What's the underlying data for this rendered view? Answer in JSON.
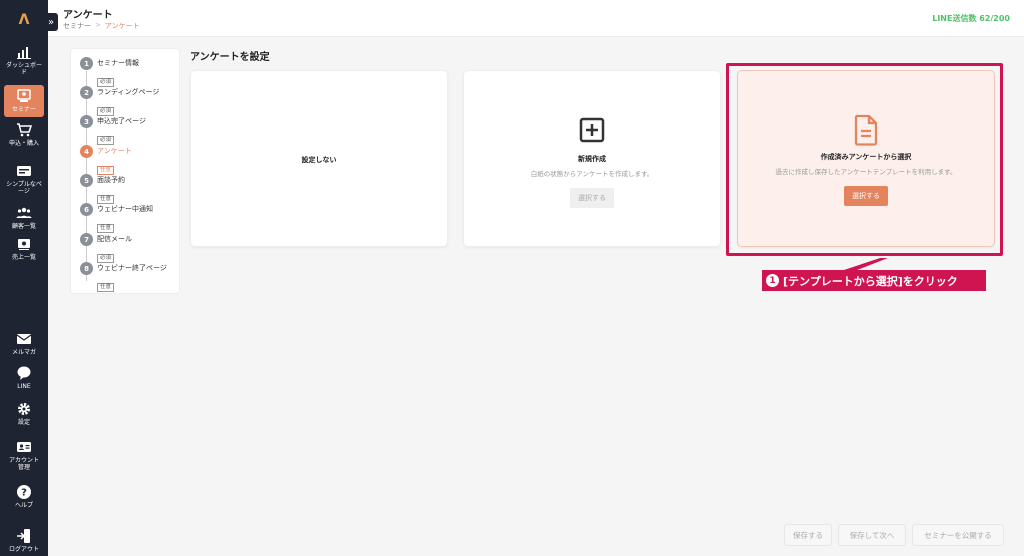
{
  "app": {
    "logo": "Λ"
  },
  "sidebar": {
    "items": [
      {
        "label": "ダッシュボード",
        "icon": "chart-icon"
      },
      {
        "label": "セミナー",
        "icon": "seminar-icon"
      },
      {
        "label": "申込・購入",
        "icon": "cart-icon"
      },
      {
        "label": "シンプルなページ",
        "icon": "page-icon"
      },
      {
        "label": "顧客一覧",
        "icon": "users-icon"
      },
      {
        "label": "売上一覧",
        "icon": "sales-icon"
      },
      {
        "label": "メルマガ",
        "icon": "mail-icon"
      },
      {
        "label": "LINE",
        "icon": "line-icon"
      },
      {
        "label": "設定",
        "icon": "gear-icon"
      },
      {
        "label": "アカウント管理",
        "icon": "account-icon"
      },
      {
        "label": "ヘルプ",
        "icon": "help-icon"
      },
      {
        "label": "ログアウト",
        "icon": "logout-icon"
      }
    ]
  },
  "header": {
    "title": "アンケート",
    "breadcrumb": {
      "parent": "セミナー",
      "separator": ">",
      "current": "アンケート"
    },
    "line_count": "LINE送信数 62/200"
  },
  "steps": [
    {
      "num": "1",
      "label": "セミナー情報",
      "badge": "必須"
    },
    {
      "num": "2",
      "label": "ランディングページ",
      "badge": "必須"
    },
    {
      "num": "3",
      "label": "申込完了ページ",
      "badge": "必須"
    },
    {
      "num": "4",
      "label": "アンケート",
      "badge": "任意"
    },
    {
      "num": "5",
      "label": "面談予約",
      "badge": "任意"
    },
    {
      "num": "6",
      "label": "ウェビナー中通知",
      "badge": "任意"
    },
    {
      "num": "7",
      "label": "配信メール",
      "badge": "必須"
    },
    {
      "num": "8",
      "label": "ウェビナー終了ページ",
      "badge": "任意"
    }
  ],
  "main": {
    "section_title": "アンケートを設定",
    "cards": {
      "none": {
        "title": "設定しない"
      },
      "new": {
        "title": "新規作成",
        "desc": "白紙の状態からアンケートを作成します。",
        "button": "選択する"
      },
      "template": {
        "title": "作成済みアンケートから選択",
        "desc": "過去に作成し保存したアンケートテンプレートを利用します。",
        "button": "選択する"
      }
    }
  },
  "annotation": {
    "num": "1",
    "text": "[テンプレートから選択]をクリック"
  },
  "footer": {
    "save": "保存する",
    "save_next": "保存して次へ",
    "publish": "セミナーを公開する"
  },
  "colors": {
    "accent": "#e4845f",
    "annotation": "#cf1452",
    "sidebar": "#1f2433",
    "line_green": "#52c06a"
  }
}
